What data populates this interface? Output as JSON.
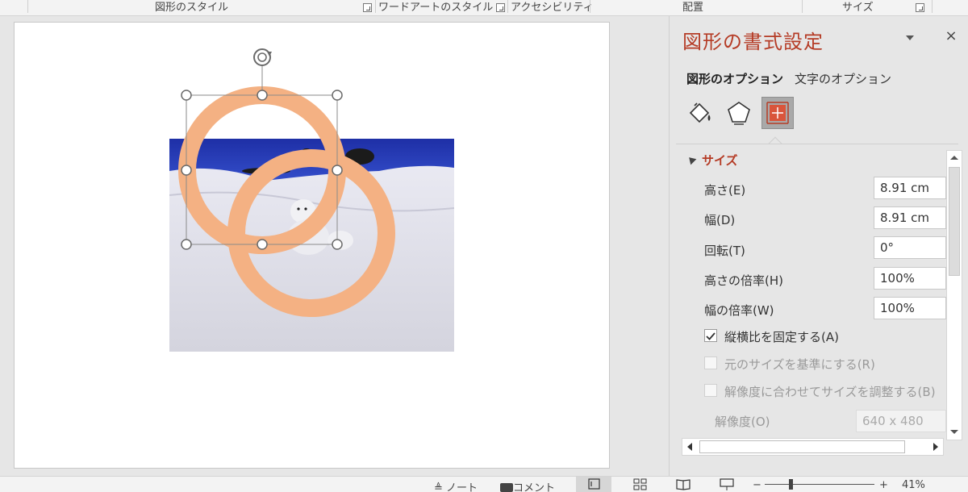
{
  "ribbon": {
    "groups": {
      "shape_styles": "図形のスタイル",
      "wordart_styles": "ワードアートのスタイル",
      "accessibility": "アクセシビリティ",
      "arrange": "配置",
      "size": "サイズ"
    }
  },
  "pane": {
    "title": "図形の書式設定",
    "close_label": "×",
    "tabs": {
      "shape_options": "図形のオプション",
      "text_options": "文字のオプション"
    },
    "section": {
      "title": "サイズ",
      "height_label": "高さ(E)",
      "height_value": "8.91 cm",
      "width_label": "幅(D)",
      "width_value": "8.91 cm",
      "rotation_label": "回転(T)",
      "rotation_value": "0°",
      "scale_height_label": "高さの倍率(H)",
      "scale_height_value": "100%",
      "scale_width_label": "幅の倍率(W)",
      "scale_width_value": "100%",
      "lock_aspect_label": "縦横比を固定する(A)",
      "lock_aspect_checked": true,
      "relative_original_label": "元のサイズを基準にする(R)",
      "best_scale_label": "解像度に合わせてサイズを調整する(B)",
      "resolution_label": "解像度(O)",
      "resolution_value": "640 x 480"
    }
  },
  "statusbar": {
    "notes_label": "ノート",
    "comments_label": "コメント",
    "zoom_minus": "−",
    "zoom_plus": "+",
    "zoom_level": "41%"
  },
  "colors": {
    "accent_red": "#b53c26",
    "ring_color": "#f4b183",
    "sky_blue": "#2b3bb0"
  }
}
